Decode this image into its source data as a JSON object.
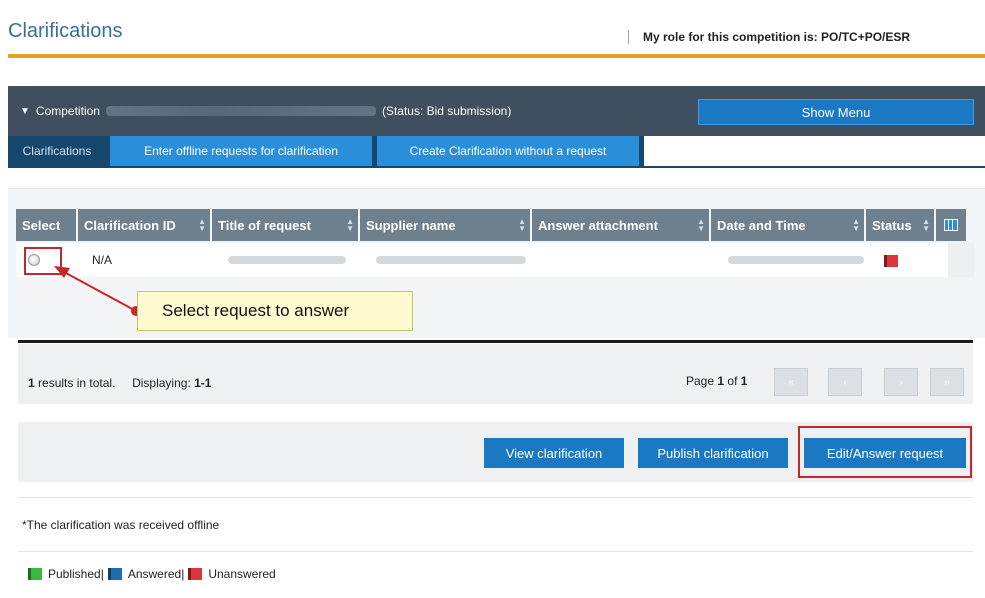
{
  "header": {
    "title": "Clarifications",
    "role_label": "My role for this competition is:",
    "role_value": "PO/TC+PO/ESR"
  },
  "competition": {
    "label": "Competition",
    "status": "(Status: Bid submission)",
    "show_menu": "Show Menu"
  },
  "tabs": [
    {
      "label": "Clarifications"
    },
    {
      "label": "Enter offline requests for clarification"
    },
    {
      "label": "Create Clarification without a request"
    }
  ],
  "grid": {
    "columns": [
      "Select",
      "Clarification ID",
      "Title of request",
      "Supplier name",
      "Answer attachment",
      "Date and Time",
      "Status"
    ],
    "rows": [
      {
        "clarification_id": "N/A",
        "status": "Unanswered"
      }
    ]
  },
  "callout": "Select request to answer",
  "results": {
    "total_count": "1",
    "total_suffix": "results in total.",
    "displaying_label": "Displaying:",
    "displaying_range": "1-1",
    "page_label": "Page",
    "page_current": "1",
    "page_of": "of",
    "page_total": "1"
  },
  "actions": {
    "view": "View clarification",
    "publish": "Publish clarification",
    "edit": "Edit/Answer request"
  },
  "note": "*The clarification was received offline",
  "legend": {
    "published": "Published|",
    "answered": "Answered|",
    "unanswered": "Unanswered"
  },
  "colors": {
    "accent_orange": "#e8a020",
    "button_blue": "#1b78c2",
    "highlight_red": "#c8252a"
  }
}
